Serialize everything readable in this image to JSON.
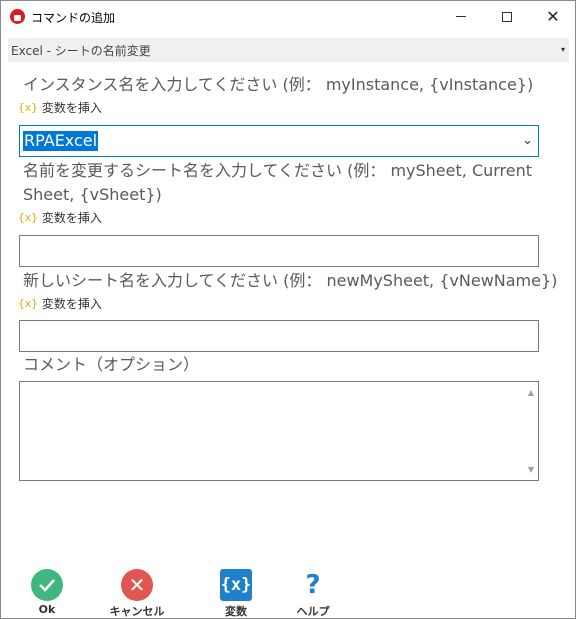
{
  "window": {
    "title": "コマンドの追加",
    "minimize_glyph": "",
    "maximize_glyph": "",
    "close_glyph": "✕"
  },
  "command_selector": {
    "value": "Excel - シートの名前変更",
    "arrow": "▾"
  },
  "fields": {
    "instance": {
      "label": "インスタンス名を入力してください (例： myInstance, {vInstance})",
      "insert_var": "変数を挿入",
      "value": "RPAExcel",
      "arrow": "⌄"
    },
    "sheet_name": {
      "label_line1": "名前を変更するシート名を入力してください (例： mySheet, Current",
      "label_line2": "Sheet, {vSheet})",
      "insert_var": "変数を挿入",
      "value": ""
    },
    "new_name": {
      "label": "新しいシート名を入力してください (例： newMySheet, {vNewName})",
      "insert_var": "変数を挿入",
      "value": ""
    },
    "comment": {
      "label": "コメント（オプション）",
      "value": ""
    }
  },
  "var_icon_glyph": "{x}",
  "toolbar": {
    "ok_label": "Ok",
    "cancel_label": "キャンセル",
    "variables_label": "変数",
    "help_label": "ヘルプ",
    "var_icon_text": "{x}",
    "help_icon_text": "?",
    "cancel_icon_text": "✕"
  },
  "colors": {
    "ok": "#3fb77e",
    "cancel": "#e0574f",
    "accent": "#0078d7",
    "var_icon": "#1e80c8"
  }
}
